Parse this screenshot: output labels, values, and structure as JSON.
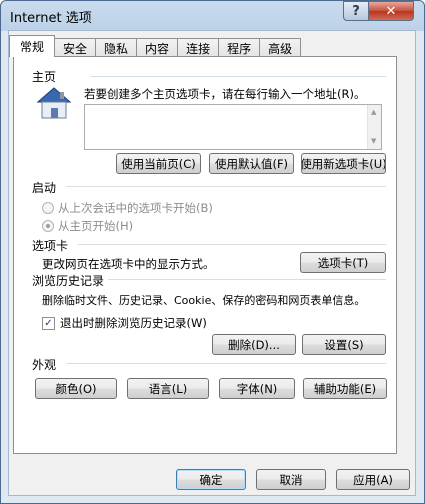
{
  "window": {
    "title": "Internet 选项"
  },
  "titlebar": {
    "help_glyph": "?",
    "close_glyph": "✕"
  },
  "tabs": [
    {
      "label": "常规",
      "active": true
    },
    {
      "label": "安全"
    },
    {
      "label": "隐私"
    },
    {
      "label": "内容"
    },
    {
      "label": "连接"
    },
    {
      "label": "程序"
    },
    {
      "label": "高级"
    }
  ],
  "home": {
    "heading": "主页",
    "instruction": "若要创建多个主页选项卡，请在每行输入一个地址(R)。",
    "address_value": "",
    "use_current_label": "使用当前页(C)",
    "use_default_label": "使用默认值(F)",
    "use_new_tab_label": "使用新选项卡(U)"
  },
  "startup": {
    "heading": "启动",
    "option_last_session": "从上次会话中的选项卡开始(B)",
    "option_home_page": "从主页开始(H)"
  },
  "tabs_section": {
    "heading": "选项卡",
    "description": "更改网页在选项卡中的显示方式。",
    "button_label": "选项卡(T)"
  },
  "history": {
    "heading": "浏览历史记录",
    "description": "删除临时文件、历史记录、Cookie、保存的密码和网页表单信息。",
    "delete_on_exit_label": "退出时删除浏览历史记录(W)",
    "delete_on_exit_checked": true,
    "delete_label": "删除(D)...",
    "settings_label": "设置(S)"
  },
  "appearance": {
    "heading": "外观",
    "colors_label": "颜色(O)",
    "languages_label": "语言(L)",
    "fonts_label": "字体(N)",
    "accessibility_label": "辅助功能(E)"
  },
  "footer": {
    "ok_label": "确定",
    "cancel_label": "取消",
    "apply_label": "应用(A)"
  }
}
